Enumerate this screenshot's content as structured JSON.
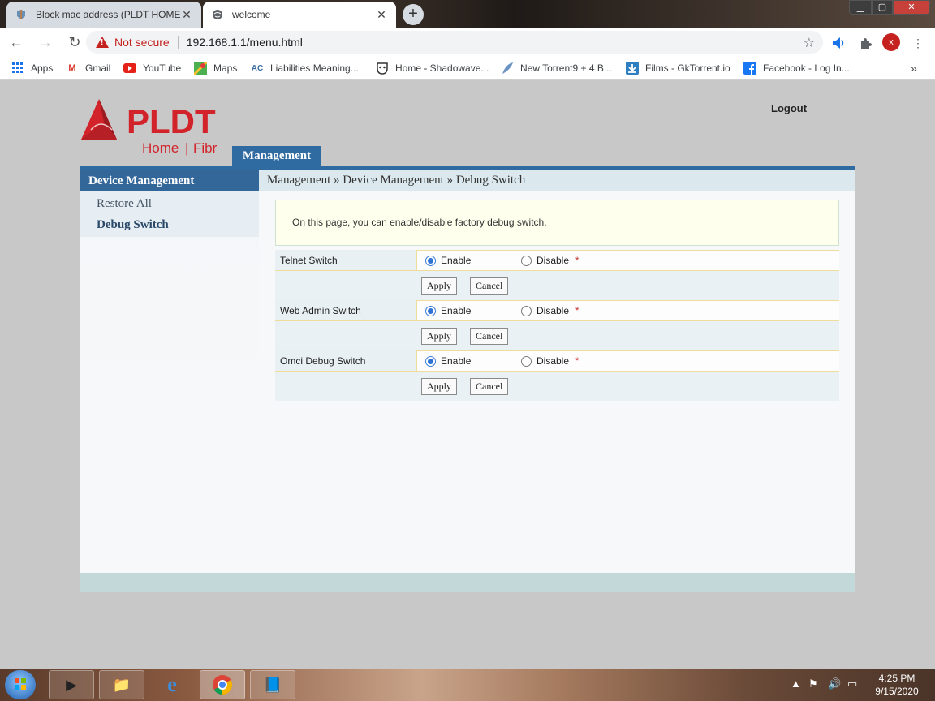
{
  "browser": {
    "tabs": [
      {
        "title": "Block mac address (PLDT HOME",
        "active": false,
        "icon": "router-icon"
      },
      {
        "title": "welcome",
        "active": true,
        "icon": "globe-icon"
      }
    ],
    "new_tab_label": "+",
    "security_label": "Not secure",
    "url": "192.168.1.1/menu.html",
    "avatar_letter": "x",
    "bookmarks": [
      {
        "label": "Apps",
        "icon": "apps-grid-icon"
      },
      {
        "label": "Gmail",
        "icon": "gmail-icon"
      },
      {
        "label": "YouTube",
        "icon": "youtube-icon"
      },
      {
        "label": "Maps",
        "icon": "maps-icon"
      },
      {
        "label": "Liabilities Meaning...",
        "icon": "ac-icon"
      },
      {
        "label": "Home - Shadowave...",
        "icon": "mask-icon"
      },
      {
        "label": "New Torrent9 + 4 B...",
        "icon": "feather-icon"
      },
      {
        "label": "Films - GkTorrent.io",
        "icon": "download-icon"
      },
      {
        "label": "Facebook - Log In...",
        "icon": "facebook-icon"
      }
    ]
  },
  "router": {
    "logo": {
      "brand": "PLDT",
      "sub_left": "Home",
      "sub_sep": "|",
      "sub_right": "Fibr"
    },
    "logout_label": "Logout",
    "menu_tab": "Management",
    "sidebar": {
      "heading": "Device Management",
      "items": [
        {
          "label": "Restore All",
          "active": false
        },
        {
          "label": "Debug Switch",
          "active": true
        }
      ]
    },
    "breadcrumb": "Management » Device Management » Debug Switch",
    "info_text": "On this page, you can enable/disable factory debug switch.",
    "switches": [
      {
        "label": "Telnet Switch",
        "enable": "Enable",
        "disable": "Disable",
        "selected": "enable",
        "required": "*",
        "apply": "Apply",
        "cancel": "Cancel"
      },
      {
        "label": "Web Admin Switch",
        "enable": "Enable",
        "disable": "Disable",
        "selected": "enable",
        "required": "*",
        "apply": "Apply",
        "cancel": "Cancel"
      },
      {
        "label": "Omci Debug Switch",
        "enable": "Enable",
        "disable": "Disable",
        "selected": "enable",
        "required": "*",
        "apply": "Apply",
        "cancel": "Cancel"
      }
    ]
  },
  "taskbar": {
    "time": "4:25 PM",
    "date": "9/15/2020"
  },
  "colors": {
    "brand_red": "#d2232a",
    "nav_blue": "#2f6aa0",
    "page_bg": "#c8c8c8"
  }
}
